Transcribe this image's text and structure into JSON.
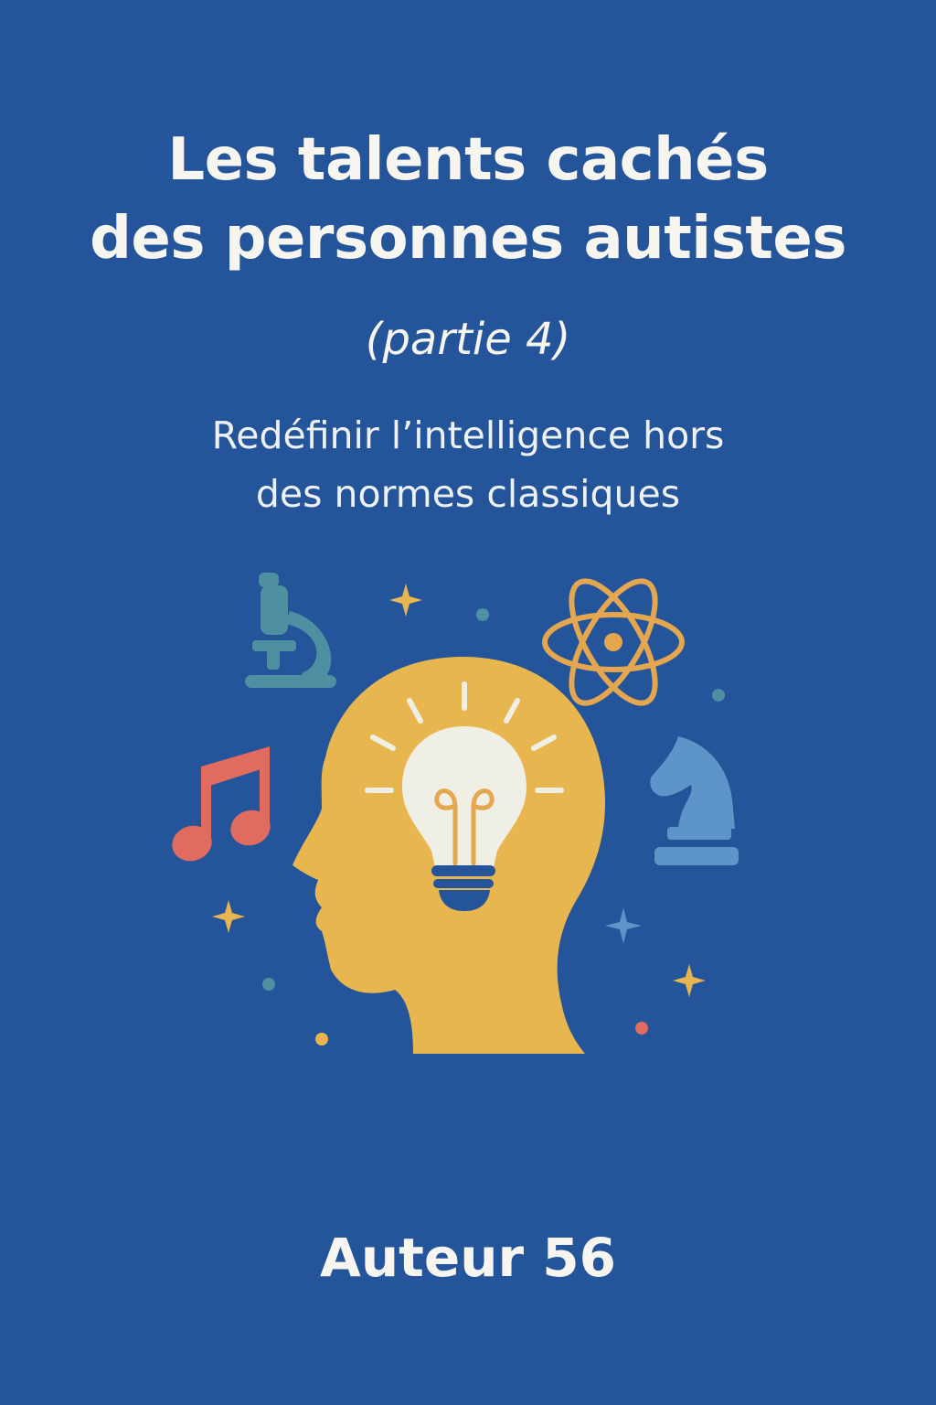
{
  "cover": {
    "title_line_1": "Les talents cachés",
    "title_line_2": "des personnes autistes",
    "part": "(partie 4)",
    "subtitle_line_1": "Redéfinir l’intelligence hors",
    "subtitle_line_2": "des normes classiques",
    "author": "Auteur 56"
  },
  "colors": {
    "background": "#24549a",
    "text": "#f7f5ef",
    "head": "#e8b64f",
    "bulb": "#f0efe6",
    "bulb_base": "#24549a",
    "music_note": "#e06b5e",
    "microscope": "#4e8fa2",
    "atom": "#e4a64e",
    "chess_knight": "#5d95c8"
  },
  "icons": [
    "microscope-icon",
    "atom-icon",
    "music-note-icon",
    "chess-knight-icon",
    "head-silhouette-icon",
    "lightbulb-icon",
    "sparkle-icon"
  ]
}
